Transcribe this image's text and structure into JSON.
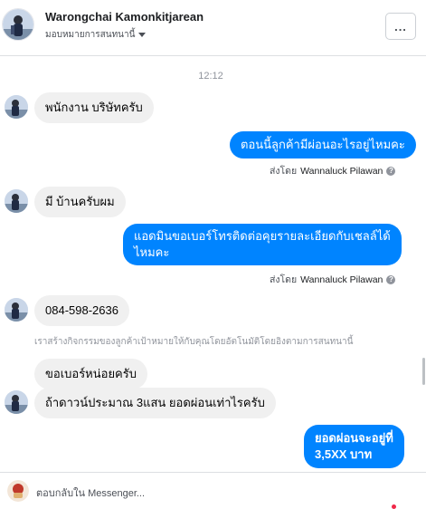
{
  "header": {
    "name": "Warongchai Kamonkitjarean",
    "assign_label": "มอบหมายการสนทนานี้",
    "menu_label": "..."
  },
  "timestamp": "12:12",
  "messages": [
    {
      "text": "พนักงาน บริษัทครับ"
    },
    {
      "text": "ตอนนี้ลูกค้ามีผ่อนอะไรอยู่ไหมคะ",
      "sent_by_label": "ส่งโดย",
      "sender": "Wannaluck Pilawan"
    },
    {
      "text": "มี บ้านครับผม"
    },
    {
      "text_line1": "แอดมินขอเบอร์โทรติดต่อคุยรายละเอียดกับเชลล์ได้",
      "text_line2": "ไหมคะ",
      "sent_by_label": "ส่งโดย",
      "sender": "Wannaluck Pilawan"
    },
    {
      "text": "084-598-2636"
    },
    {
      "text": "ขอเบอร์หน่อยครับ"
    },
    {
      "text": "ถ้าดาวน์ประมาณ 3แสน ยอดผ่อนเท่าไรครับ"
    },
    {
      "text_line1": "ยอดผ่อนจะอยู่ที่",
      "text_line2": "3,5XX บาท"
    }
  ],
  "system_note": "เราสร้างกิจกรรมของลูกค้าเป้าหมายให้กับคุณโดยอัตโนมัติโดยอิงตามการสนทนานี้",
  "composer": {
    "placeholder": "ตอบกลับใน Messenger..."
  },
  "colors": {
    "outgoing_bubble": "#0084ff",
    "incoming_bubble": "#f0f0f0",
    "notification_dot": "#f02849"
  }
}
